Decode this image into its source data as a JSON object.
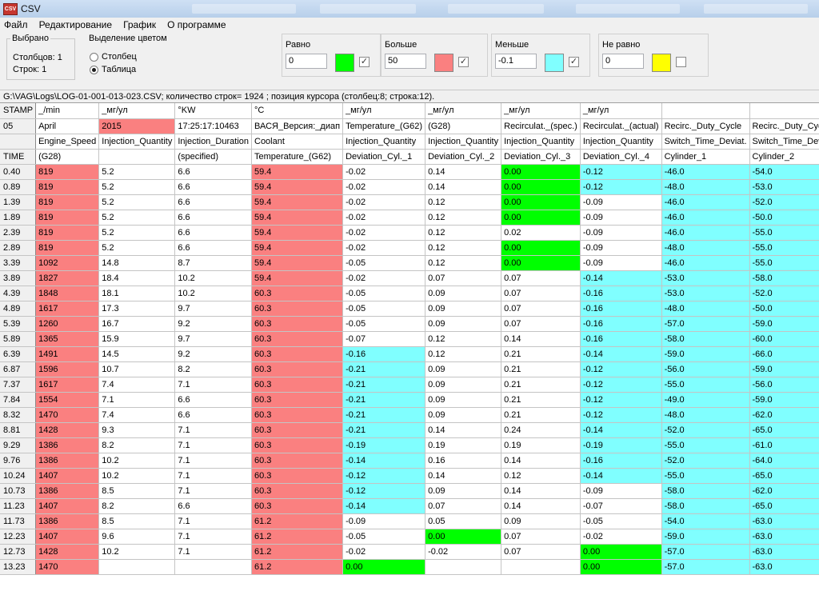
{
  "window": {
    "title": "CSV"
  },
  "menu": [
    "Файл",
    "Редактирование",
    "График",
    "О программе"
  ],
  "selected": {
    "legend": "Выбрано",
    "cols": "Столбцов: 1",
    "rows": "Строк: 1"
  },
  "highlight": {
    "legend": "Выделение цветом",
    "opt1": "Столбец",
    "opt2": "Таблица",
    "selected": "Таблица"
  },
  "filters": [
    {
      "label": "Равно",
      "value": "0",
      "color": "#00ff00",
      "checked": true
    },
    {
      "label": "Больше",
      "value": "50",
      "color": "#fa8080",
      "checked": true
    },
    {
      "label": "Меньше",
      "value": "-0.1",
      "color": "#80ffff",
      "checked": true
    },
    {
      "label": "Не равно",
      "value": "0",
      "color": "#ffff00",
      "checked": false
    }
  ],
  "status": "G:\\VAG\\Logs\\LOG-01-001-013-023.CSV;  количество строк= 1924 ; позиция курсора (столбец:8; строка:12).",
  "grid": {
    "header_rows": [
      [
        "STAMP",
        "_/min",
        "_мг/ул",
        "°KW",
        "°C",
        "_мг/ул",
        "_мг/ул",
        "_мг/ул",
        "_мг/ул",
        "",
        ""
      ],
      [
        "05",
        "April",
        "2015",
        "17:25:17:10463",
        "ВАСЯ_Версия:_диап",
        "Temperature_(G62)",
        "(G28)",
        "Recirculat._(spec.)",
        "Recirculat._(actual)",
        "Recirc._Duty_Cycle",
        "Recirc._Duty_Cycle"
      ],
      [
        "",
        "Engine_Speed",
        "Injection_Quantity",
        "Injection_Duration",
        "Coolant",
        "Injection_Quantity",
        "Injection_Quantity",
        "Injection_Quantity",
        "Injection_Quantity",
        "Switch_Time_Deviat.",
        "Switch_Time_Deviat."
      ],
      [
        "TIME",
        "(G28)",
        "",
        "(specified)",
        "Temperature_(G62)",
        "Deviation_Cyl._1",
        "Deviation_Cyl._2",
        "Deviation_Cyl._3",
        "Deviation_Cyl._4",
        "Cylinder_1",
        "Cylinder_2"
      ]
    ],
    "rows": [
      [
        "0.40",
        "819",
        "5.2",
        "6.6",
        "59.4",
        "-0.02",
        "0.14",
        "0.00",
        "-0.12",
        "-46.0",
        "-54.0"
      ],
      [
        "0.89",
        "819",
        "5.2",
        "6.6",
        "59.4",
        "-0.02",
        "0.14",
        "0.00",
        "-0.12",
        "-48.0",
        "-53.0"
      ],
      [
        "1.39",
        "819",
        "5.2",
        "6.6",
        "59.4",
        "-0.02",
        "0.12",
        "0.00",
        "-0.09",
        "-46.0",
        "-52.0"
      ],
      [
        "1.89",
        "819",
        "5.2",
        "6.6",
        "59.4",
        "-0.02",
        "0.12",
        "0.00",
        "-0.09",
        "-46.0",
        "-50.0"
      ],
      [
        "2.39",
        "819",
        "5.2",
        "6.6",
        "59.4",
        "-0.02",
        "0.12",
        "0.02",
        "-0.09",
        "-46.0",
        "-55.0"
      ],
      [
        "2.89",
        "819",
        "5.2",
        "6.6",
        "59.4",
        "-0.02",
        "0.12",
        "0.00",
        "-0.09",
        "-48.0",
        "-55.0"
      ],
      [
        "3.39",
        "1092",
        "14.8",
        "8.7",
        "59.4",
        "-0.05",
        "0.12",
        "0.00",
        "-0.09",
        "-46.0",
        "-55.0"
      ],
      [
        "3.89",
        "1827",
        "18.4",
        "10.2",
        "59.4",
        "-0.02",
        "0.07",
        "0.07",
        "-0.14",
        "-53.0",
        "-58.0"
      ],
      [
        "4.39",
        "1848",
        "18.1",
        "10.2",
        "60.3",
        "-0.05",
        "0.09",
        "0.07",
        "-0.16",
        "-53.0",
        "-52.0"
      ],
      [
        "4.89",
        "1617",
        "17.3",
        "9.7",
        "60.3",
        "-0.05",
        "0.09",
        "0.07",
        "-0.16",
        "-48.0",
        "-50.0"
      ],
      [
        "5.39",
        "1260",
        "16.7",
        "9.2",
        "60.3",
        "-0.05",
        "0.09",
        "0.07",
        "-0.16",
        "-57.0",
        "-59.0"
      ],
      [
        "5.89",
        "1365",
        "15.9",
        "9.7",
        "60.3",
        "-0.07",
        "0.12",
        "0.14",
        "-0.16",
        "-58.0",
        "-60.0"
      ],
      [
        "6.39",
        "1491",
        "14.5",
        "9.2",
        "60.3",
        "-0.16",
        "0.12",
        "0.21",
        "-0.14",
        "-59.0",
        "-66.0"
      ],
      [
        "6.87",
        "1596",
        "10.7",
        "8.2",
        "60.3",
        "-0.21",
        "0.09",
        "0.21",
        "-0.12",
        "-56.0",
        "-59.0"
      ],
      [
        "7.37",
        "1617",
        "7.4",
        "7.1",
        "60.3",
        "-0.21",
        "0.09",
        "0.21",
        "-0.12",
        "-55.0",
        "-56.0"
      ],
      [
        "7.84",
        "1554",
        "7.1",
        "6.6",
        "60.3",
        "-0.21",
        "0.09",
        "0.21",
        "-0.12",
        "-49.0",
        "-59.0"
      ],
      [
        "8.32",
        "1470",
        "7.4",
        "6.6",
        "60.3",
        "-0.21",
        "0.09",
        "0.21",
        "-0.12",
        "-48.0",
        "-62.0"
      ],
      [
        "8.81",
        "1428",
        "9.3",
        "7.1",
        "60.3",
        "-0.21",
        "0.14",
        "0.24",
        "-0.14",
        "-52.0",
        "-65.0"
      ],
      [
        "9.29",
        "1386",
        "8.2",
        "7.1",
        "60.3",
        "-0.19",
        "0.19",
        "0.19",
        "-0.19",
        "-55.0",
        "-61.0"
      ],
      [
        "9.76",
        "1386",
        "10.2",
        "7.1",
        "60.3",
        "-0.14",
        "0.16",
        "0.14",
        "-0.16",
        "-52.0",
        "-64.0"
      ],
      [
        "10.24",
        "1407",
        "10.2",
        "7.1",
        "60.3",
        "-0.12",
        "0.14",
        "0.12",
        "-0.14",
        "-55.0",
        "-65.0"
      ],
      [
        "10.73",
        "1386",
        "8.5",
        "7.1",
        "60.3",
        "-0.12",
        "0.09",
        "0.14",
        "-0.09",
        "-58.0",
        "-62.0"
      ],
      [
        "11.23",
        "1407",
        "8.2",
        "6.6",
        "60.3",
        "-0.14",
        "0.07",
        "0.14",
        "-0.07",
        "-58.0",
        "-65.0"
      ],
      [
        "11.73",
        "1386",
        "8.5",
        "7.1",
        "61.2",
        "-0.09",
        "0.05",
        "0.09",
        "-0.05",
        "-54.0",
        "-63.0"
      ],
      [
        "12.23",
        "1407",
        "9.6",
        "7.1",
        "61.2",
        "-0.05",
        "0.00",
        "0.07",
        "-0.02",
        "-59.0",
        "-63.0"
      ],
      [
        "12.73",
        "1428",
        "10.2",
        "7.1",
        "61.2",
        "-0.02",
        "-0.02",
        "0.07",
        "0.00",
        "-57.0",
        "-63.0"
      ],
      [
        "13.23",
        "1470",
        "",
        "",
        "61.2",
        "0.00",
        "",
        "",
        "0.00",
        "-57.0",
        "-63.0"
      ]
    ]
  }
}
